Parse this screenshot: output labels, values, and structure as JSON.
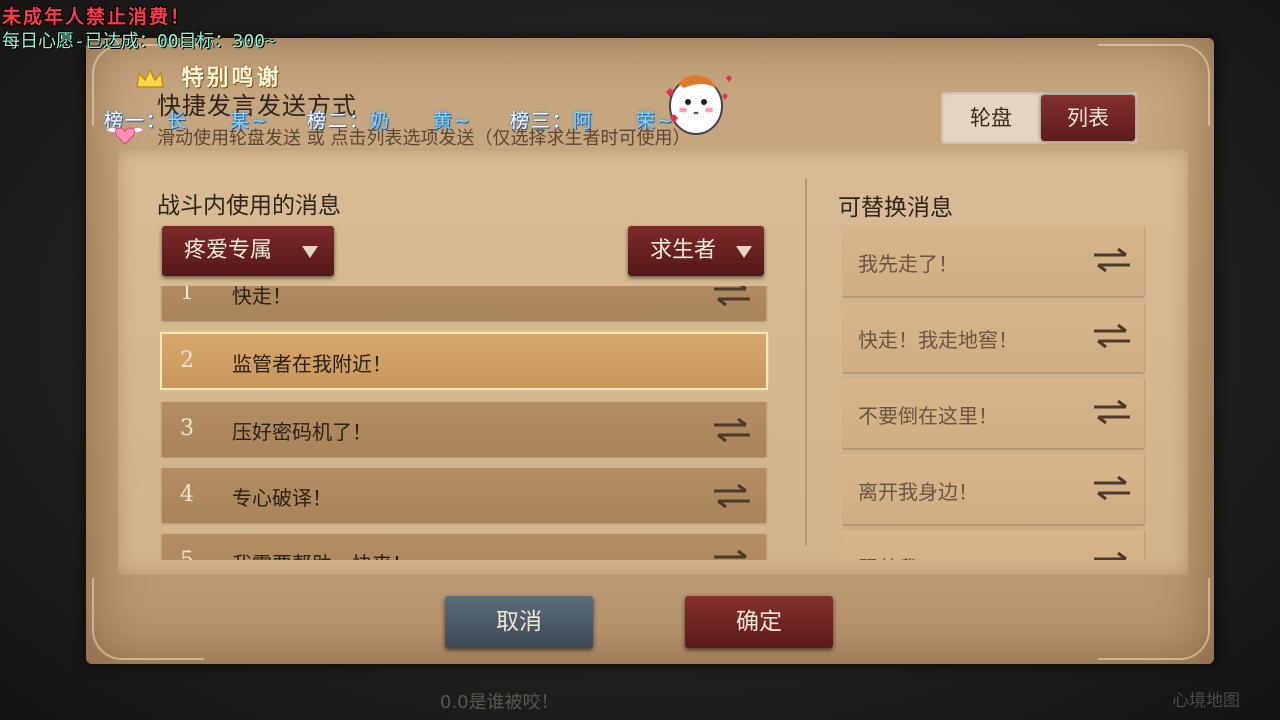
{
  "overlay": {
    "warning": "未成年人禁止消费！",
    "daily_goal": "每日心愿-已达成：00目标：300~",
    "thanks": "特别鸣谢",
    "ranks": [
      {
        "label": "榜一：",
        "name": "长　　某~"
      },
      {
        "label": "榜二：",
        "name": "奶　　黄~"
      },
      {
        "label": "榜三：",
        "name": "阿　　荣~"
      }
    ],
    "bottom_text": "0.0是谁被咬！",
    "bottom_right": "心境地图"
  },
  "dialog": {
    "title": "快捷发言发送方式",
    "subtitle": "滑动使用轮盘发送 或 点击列表选项发送（仅选择求生者时可使用）",
    "mode_toggle": {
      "wheel": "轮盘",
      "list": "列表",
      "selected": "list"
    },
    "left_section_title": "战斗内使用的消息",
    "right_section_title": "可替换消息",
    "group_dropdown": "疼爱专属",
    "role_dropdown": "求生者",
    "messages": [
      {
        "num": "1",
        "text": "快走！"
      },
      {
        "num": "2",
        "text": "监管者在我附近！",
        "selected": true
      },
      {
        "num": "3",
        "text": "压好密码机了！"
      },
      {
        "num": "4",
        "text": "专心破译！"
      },
      {
        "num": "5",
        "text": "我需要帮助，快来！"
      }
    ],
    "replaceable": [
      {
        "text": "我先走了！"
      },
      {
        "text": "快走！我走地窖！"
      },
      {
        "text": "不要倒在这里！"
      },
      {
        "text": "离开我身边！"
      },
      {
        "text": "跟着我！"
      }
    ],
    "cancel_label": "取消",
    "confirm_label": "确定"
  },
  "colors": {
    "panel": "#c8a982",
    "button_red": "#7d2b28",
    "button_blue": "#5b6c7a",
    "selected_row": "#d6a76b"
  }
}
